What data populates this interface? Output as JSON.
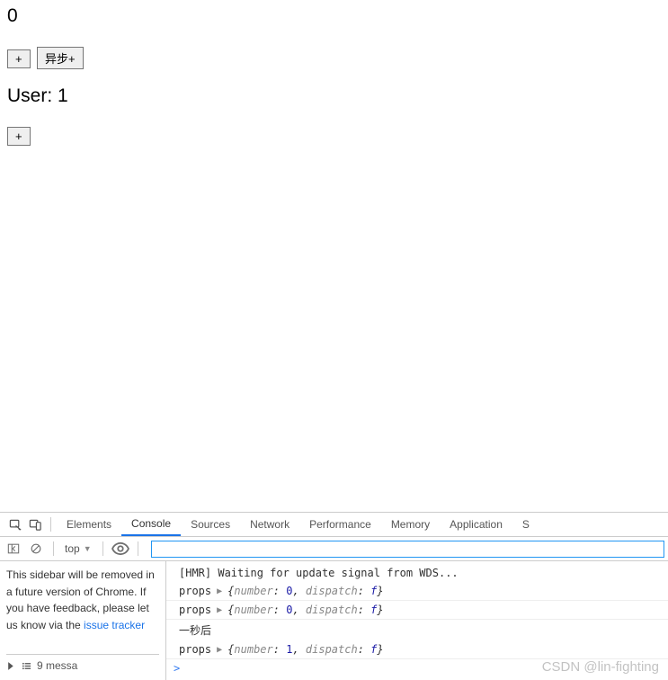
{
  "app": {
    "counter_value": "0",
    "buttons": {
      "inc": "+",
      "async_inc": "异步+"
    },
    "user_label_prefix": "User: ",
    "user_value": "1",
    "user_inc": "+"
  },
  "devtools": {
    "tabs": {
      "elements": "Elements",
      "console": "Console",
      "sources": "Sources",
      "network": "Network",
      "performance": "Performance",
      "memory": "Memory",
      "application": "Application",
      "s_overflow": "S"
    },
    "toolbar": {
      "context": "top",
      "filter_value": ""
    },
    "sidebar": {
      "notice_1": "This sidebar will be removed in a future version of Chrome. If you have feedback, please let us know via the ",
      "notice_link": "issue tracker",
      "bottom_count": "9 messa"
    },
    "logs": [
      {
        "type": "text",
        "text": "[HMR] Waiting for update signal from WDS..."
      },
      {
        "type": "obj",
        "label": "props",
        "preview": "{number: 0, dispatch: f}"
      },
      {
        "type": "obj",
        "label": "props",
        "preview": "{number: 0, dispatch: f}"
      },
      {
        "type": "text",
        "text": "一秒后"
      },
      {
        "type": "obj",
        "label": "props",
        "preview": "{number: 1, dispatch: f}"
      }
    ],
    "prompt": ">"
  },
  "watermark": "CSDN @lin-fighting"
}
